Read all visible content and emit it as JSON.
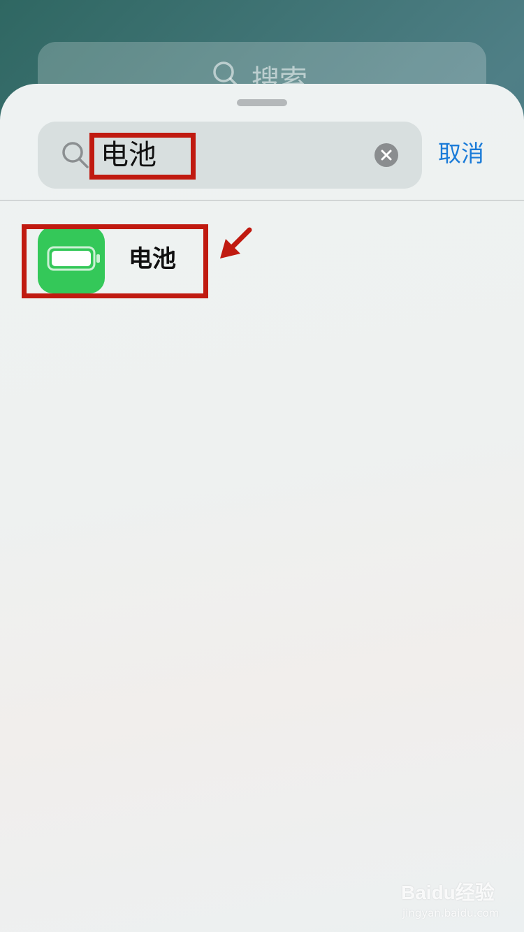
{
  "background": {
    "search_placeholder": "搜索"
  },
  "search": {
    "value": "电池",
    "cancel_label": "取消"
  },
  "results": [
    {
      "label": "电池",
      "icon": "battery-icon"
    }
  ],
  "watermark": {
    "logo": "Baidu经验",
    "url": "jingyan.baidu.com"
  },
  "colors": {
    "accent": "#1a7bd8",
    "app_icon": "#34c859",
    "highlight": "#c01a10"
  }
}
